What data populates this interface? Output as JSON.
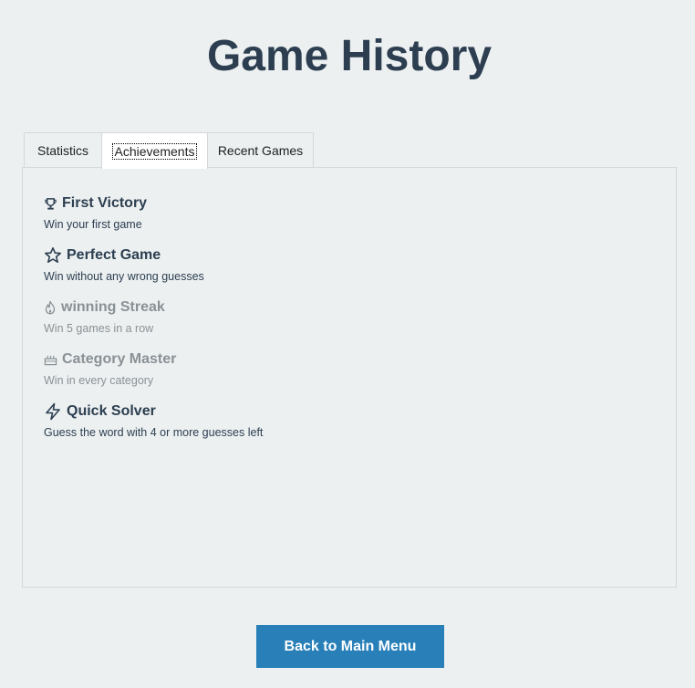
{
  "page": {
    "title": "Game History"
  },
  "tabs": [
    {
      "label": "Statistics",
      "active": false
    },
    {
      "label": "Achievements",
      "active": true
    },
    {
      "label": "Recent Games",
      "active": false
    }
  ],
  "achievements": [
    {
      "icon": "trophy-icon",
      "title": "First Victory",
      "description": "Win your first game",
      "unlocked": true
    },
    {
      "icon": "star-icon",
      "title": "Perfect Game",
      "description": "Win without any wrong guesses",
      "unlocked": true
    },
    {
      "icon": "flame-icon",
      "title": "winning Streak",
      "description": "Win 5 games in a row",
      "unlocked": false
    },
    {
      "icon": "cake-icon",
      "title": "Category Master",
      "description": "Win in every category",
      "unlocked": false
    },
    {
      "icon": "lightning-icon",
      "title": "Quick Solver",
      "description": "Guess the word with 4 or more guesses left",
      "unlocked": true
    }
  ],
  "actions": {
    "back_label": "Back to Main Menu"
  },
  "colors": {
    "background": "#ecf0f1",
    "text": "#2c3e50",
    "locked_text": "#8a9195",
    "button": "#2980b9"
  }
}
